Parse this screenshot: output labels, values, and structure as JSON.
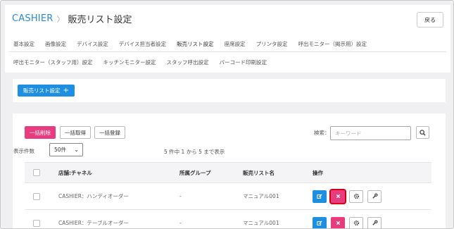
{
  "header": {
    "brand": "CASHIER",
    "page_title": "販売リスト設定",
    "back_label": "戻る"
  },
  "tabs_row1": [
    "基本設定",
    "画像設定",
    "デバイス設定",
    "デバイス担当者設定",
    "販売リスト設定",
    "座席設定",
    "プリンタ設定",
    "呼出モニター（掲示用）設定"
  ],
  "tabs_row2": [
    "呼出モニター（スタッフ用）設定",
    "キッチンモニター設定",
    "スタッフ呼出設定",
    "バーコード印刷設定"
  ],
  "active_tab": "販売リスト設定",
  "add_button": {
    "label": "販売リスト設定"
  },
  "list": {
    "bulk_delete_label": "一括削除",
    "bulk_fetch_label": "一括取得",
    "bulk_register_label": "一括登録",
    "search_label": "検索：",
    "search_placeholder": "キーワード",
    "per_page_label": "表示件数",
    "per_page_value": "50件",
    "count_text": "5 件中 1 から 5 まで表示",
    "columns": [
      "店舗:チャネル",
      "所属グループ",
      "販売リスト名",
      "操作"
    ],
    "rows": [
      {
        "store": "CASHIER：ハンディオーダー",
        "group": "-",
        "list_name": "マニュアル001"
      },
      {
        "store": "CASHIER：テーブルオーダー",
        "group": "-",
        "list_name": "マニュアル001"
      }
    ]
  },
  "colors": {
    "brand": "#2a8ad3",
    "primary": "#1e8fe0",
    "danger": "#e73c7e",
    "highlight": "#d40018"
  },
  "icons": [
    "chevron-right-icon",
    "plus-icon",
    "search-icon",
    "chevron-down-icon",
    "edit-icon",
    "delete-icon",
    "gear-icon",
    "wrench-icon"
  ]
}
